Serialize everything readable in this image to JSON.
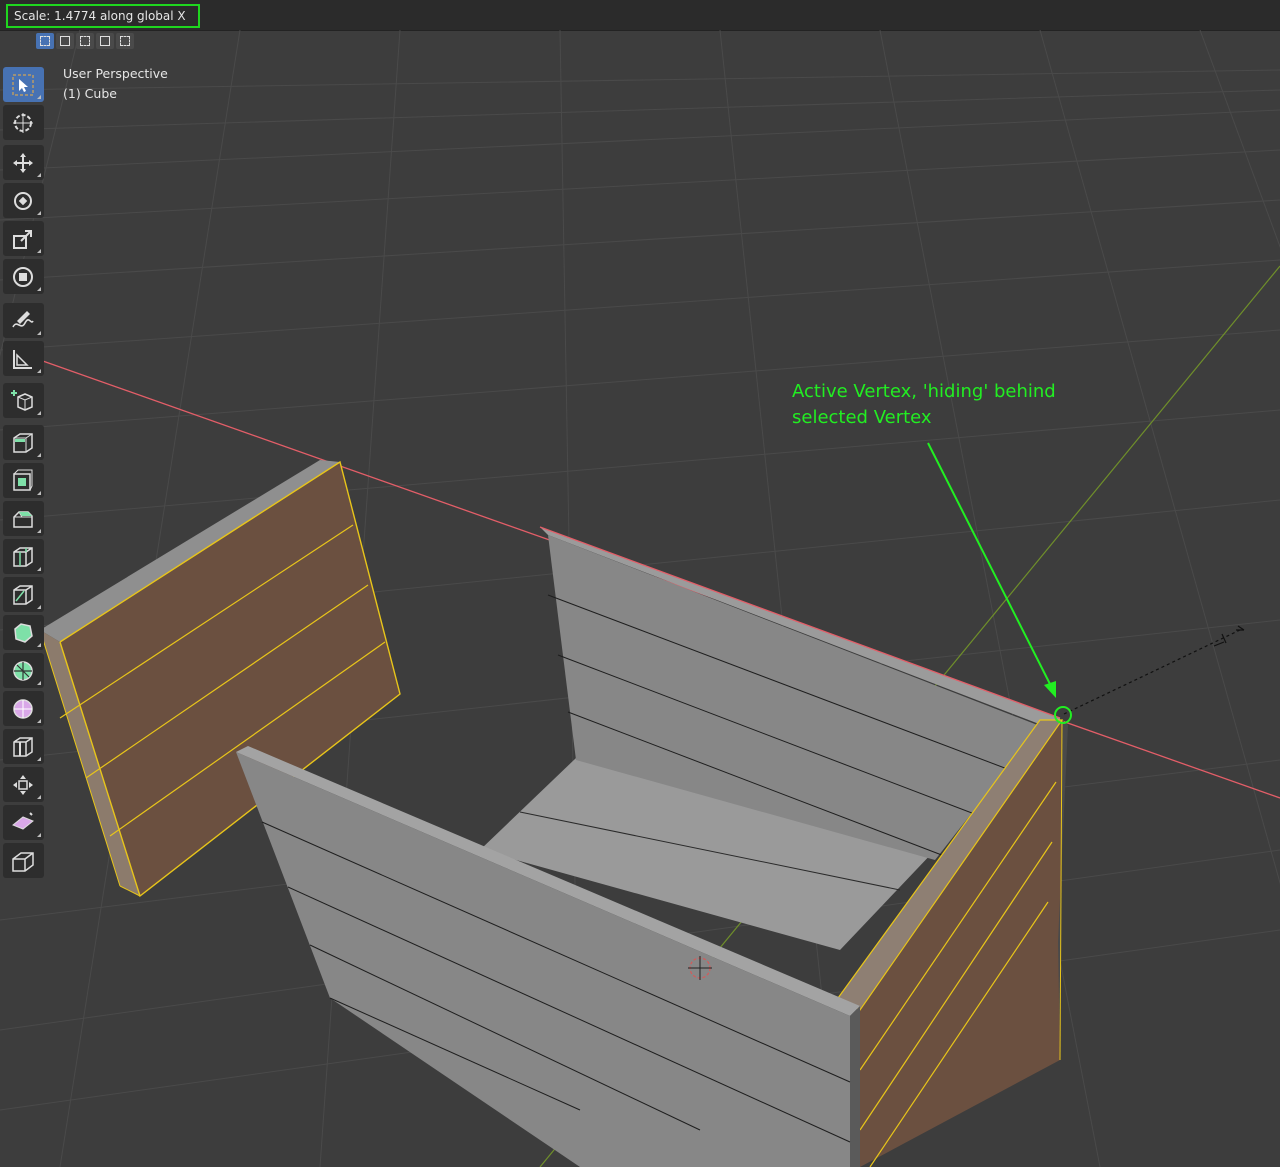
{
  "header": {
    "status_text": "Scale: 1.4774 along global X"
  },
  "select_modes": [
    "select-new-icon",
    "select-extend-icon",
    "select-subtract-icon",
    "select-difference-icon",
    "select-intersect-icon"
  ],
  "viewport": {
    "view_name": "User Perspective",
    "object_name": "(1) Cube",
    "annotation_line1": "Active Vertex, 'hiding' behind",
    "annotation_line2": "selected Vertex"
  },
  "toolbar": {
    "active": "select-box-icon",
    "items": [
      "select-box-icon",
      "cursor-icon",
      "move-icon",
      "rotate-icon",
      "scale-icon",
      "transform-icon",
      "annotate-icon",
      "measure-icon",
      "add-cube-icon",
      "extrude-icon",
      "inset-icon",
      "bevel-icon",
      "loop-cut-icon",
      "knife-icon",
      "poly-build-icon",
      "spin-icon",
      "smooth-icon",
      "edge-slide-icon",
      "shrink-fatten-icon",
      "shear-icon",
      "rip-region-icon"
    ]
  },
  "colors": {
    "annotation": "#22ee22",
    "selected_face": "#6b5040",
    "selected_edge": "#e8c51a",
    "x_axis": "#e35e68",
    "y_axis": "#7a9b2a",
    "mesh_face": "#8a8b8b",
    "active_tool": "#4772b3"
  }
}
